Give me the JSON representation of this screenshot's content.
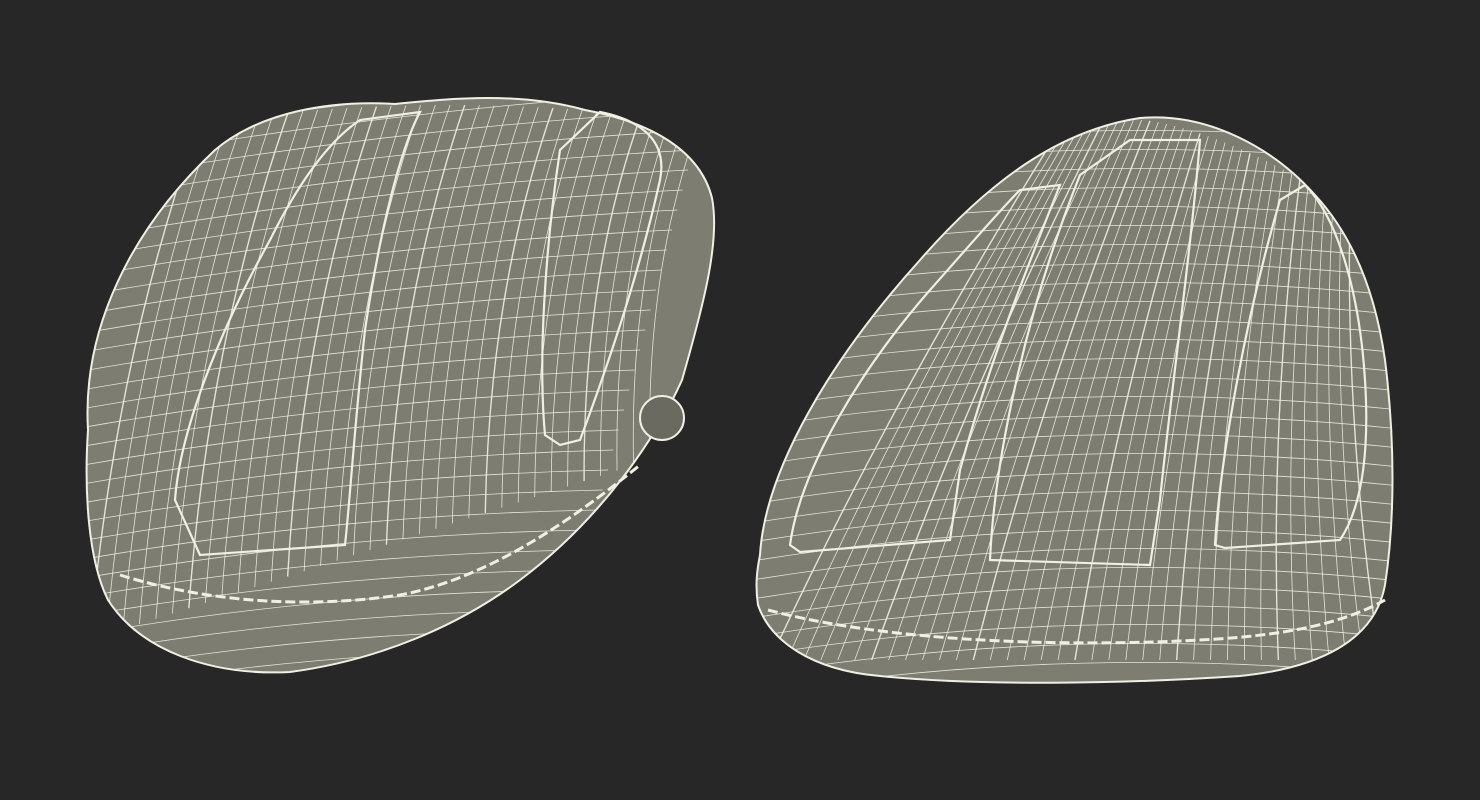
{
  "scene": {
    "background_color": "#272727",
    "surface_color": "#7d7d72",
    "surface_shade_color": "#6a6a60",
    "wire_color": "#efefe2",
    "objects": [
      {
        "name": "wireframe-case-left",
        "view": "three-quarter-left"
      },
      {
        "name": "wireframe-case-right",
        "view": "three-quarter-right"
      }
    ]
  }
}
